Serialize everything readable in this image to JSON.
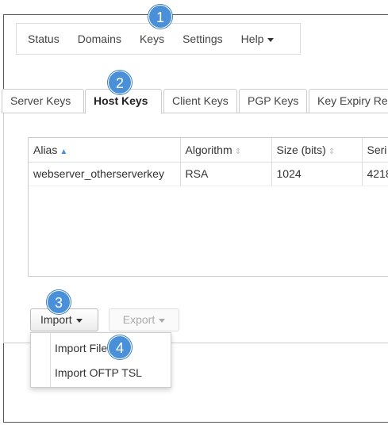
{
  "nav": {
    "status": "Status",
    "domains": "Domains",
    "keys": "Keys",
    "settings": "Settings",
    "help": "Help"
  },
  "tabs": [
    "Server Keys",
    "Host Keys",
    "Client Keys",
    "PGP Keys",
    "Key Expiry Re"
  ],
  "active_tab": "Host Keys",
  "table": {
    "headers": [
      "Alias",
      "Algorithm",
      "Size (bits)",
      "Seri"
    ],
    "rows": [
      [
        "webserver_otherserverkey",
        "RSA",
        "1024",
        "4218"
      ]
    ]
  },
  "buttons": {
    "import": "Import",
    "export": "Export"
  },
  "import_menu": [
    "Import File",
    "Import OFTP TSL"
  ],
  "callouts": [
    "1",
    "2",
    "3",
    "4"
  ],
  "colors": {
    "callout": "#4a90d9",
    "sort_active": "#4a8fd6"
  }
}
